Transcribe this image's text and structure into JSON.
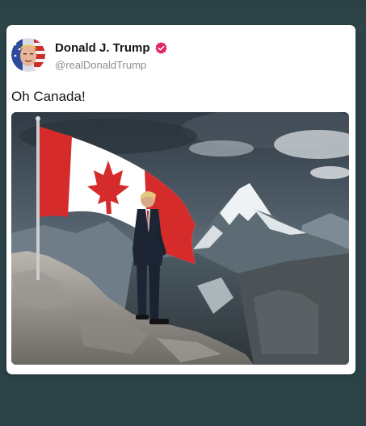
{
  "post": {
    "display_name": "Donald J. Trump",
    "handle": "@realDonaldTrump",
    "text": "Oh Canada!",
    "verified": true,
    "verified_badge_color": "#e0245e"
  },
  "image": {
    "description_icon": "post-image"
  }
}
